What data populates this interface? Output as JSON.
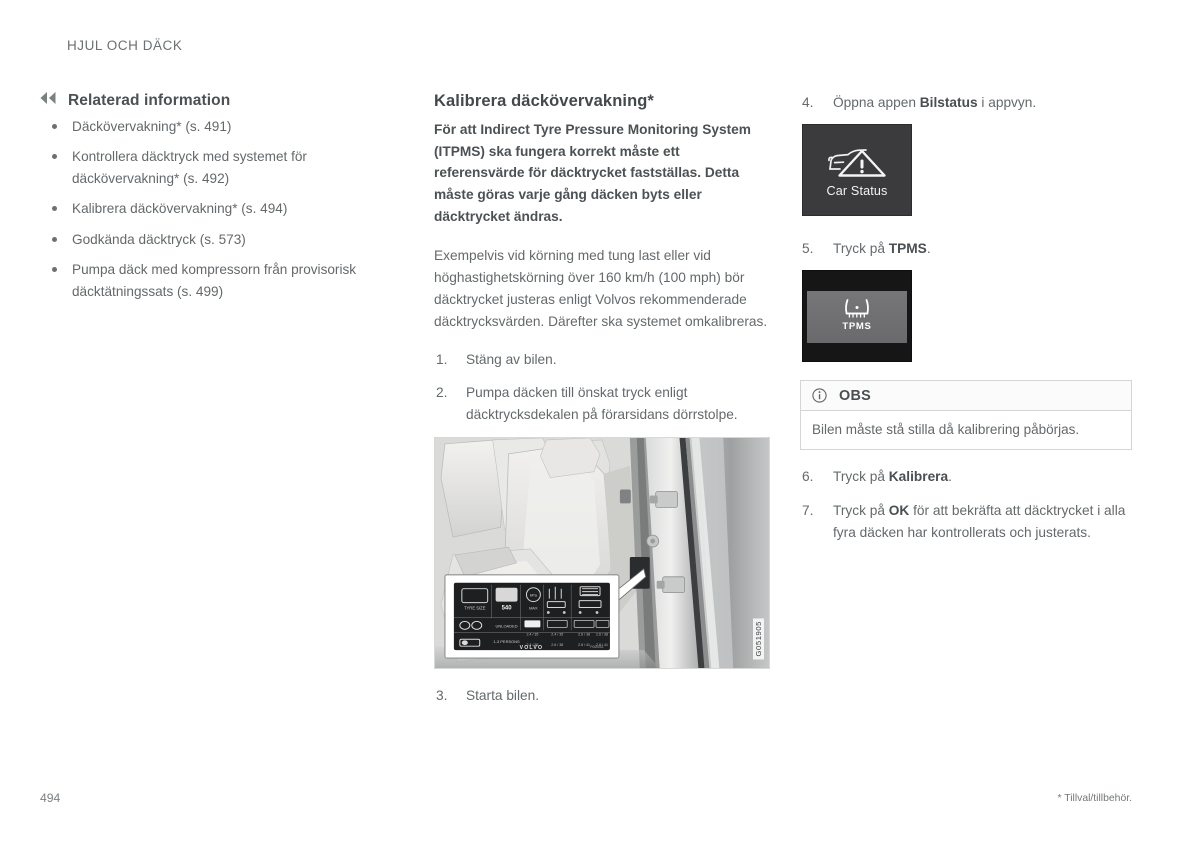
{
  "header": {
    "running_title": "HJUL OCH DÄCK"
  },
  "left_column": {
    "back_icon": "double-chevron-left-icon",
    "title": "Relaterad information",
    "links": [
      "Däckövervakning* (s. 491)",
      "Kontrollera däcktryck med systemet för däckövervakning* (s. 492)",
      "Kalibrera däckövervakning* (s. 494)",
      "Godkända däcktryck (s. 573)",
      "Pumpa däck med kompressorn från provisorisk däcktätningssats (s. 499)"
    ]
  },
  "middle_column": {
    "section_title": "Kalibrera däckövervakning*",
    "lead_paragraph": "För att Indirect Tyre Pressure Monitoring System (ITPMS) ska fungera korrekt måste ett referensvärde för däcktrycket fastställas. Detta måste göras varje gång däcken byts eller däcktrycket ändras.",
    "body_paragraph": "Exempelvis vid körning med tung last eller vid höghastighetskörning över 160 km/h (100 mph) bör däcktrycket justeras enligt Volvos rekommenderade däcktrycksvärden. Därefter ska systemet omkalibreras.",
    "steps": [
      {
        "num": "1.",
        "text": "Stäng av bilen."
      },
      {
        "num": "2.",
        "text": "Pumpa däcken till önskat tryck enligt däcktrycksdekalen på förarsidans dörrstolpe."
      }
    ],
    "figure": {
      "caption_code": "G051905",
      "alt": "Bilens förardörrstolpe med däcktrycksdekal, urklipp visar dekalen",
      "decal_brand": "VOLVO"
    },
    "step_after_figure": {
      "num": "3.",
      "text": "Starta bilen."
    }
  },
  "right_column": {
    "step4": {
      "num": "4.",
      "prefix": "Öppna appen ",
      "bold": "Bilstatus",
      "suffix": " i appvyn."
    },
    "car_status_tile": {
      "icon": "car-warning-triangle-icon",
      "label": "Car Status",
      "background": "#3b3b3d"
    },
    "step5": {
      "num": "5.",
      "prefix": "Tryck på ",
      "bold": "TPMS",
      "suffix": "."
    },
    "tpms_tile": {
      "icon": "tyre-pressure-icon",
      "label": "TPMS",
      "background": "#161617",
      "band_color": "#6e6e70"
    },
    "note": {
      "icon": "info-circle-icon",
      "title": "OBS",
      "text": "Bilen måste stå stilla då kalibrering påbörjas."
    },
    "step6": {
      "num": "6.",
      "prefix": "Tryck på ",
      "bold": "Kalibrera",
      "suffix": "."
    },
    "step7": {
      "num": "7.",
      "prefix": "Tryck på ",
      "bold": "OK",
      "suffix": " för att bekräfta att däcktrycket i alla fyra däcken har kontrollerats och justerats."
    }
  },
  "footer": {
    "page_number": "494",
    "footnote": "* Tillval/tillbehör."
  }
}
